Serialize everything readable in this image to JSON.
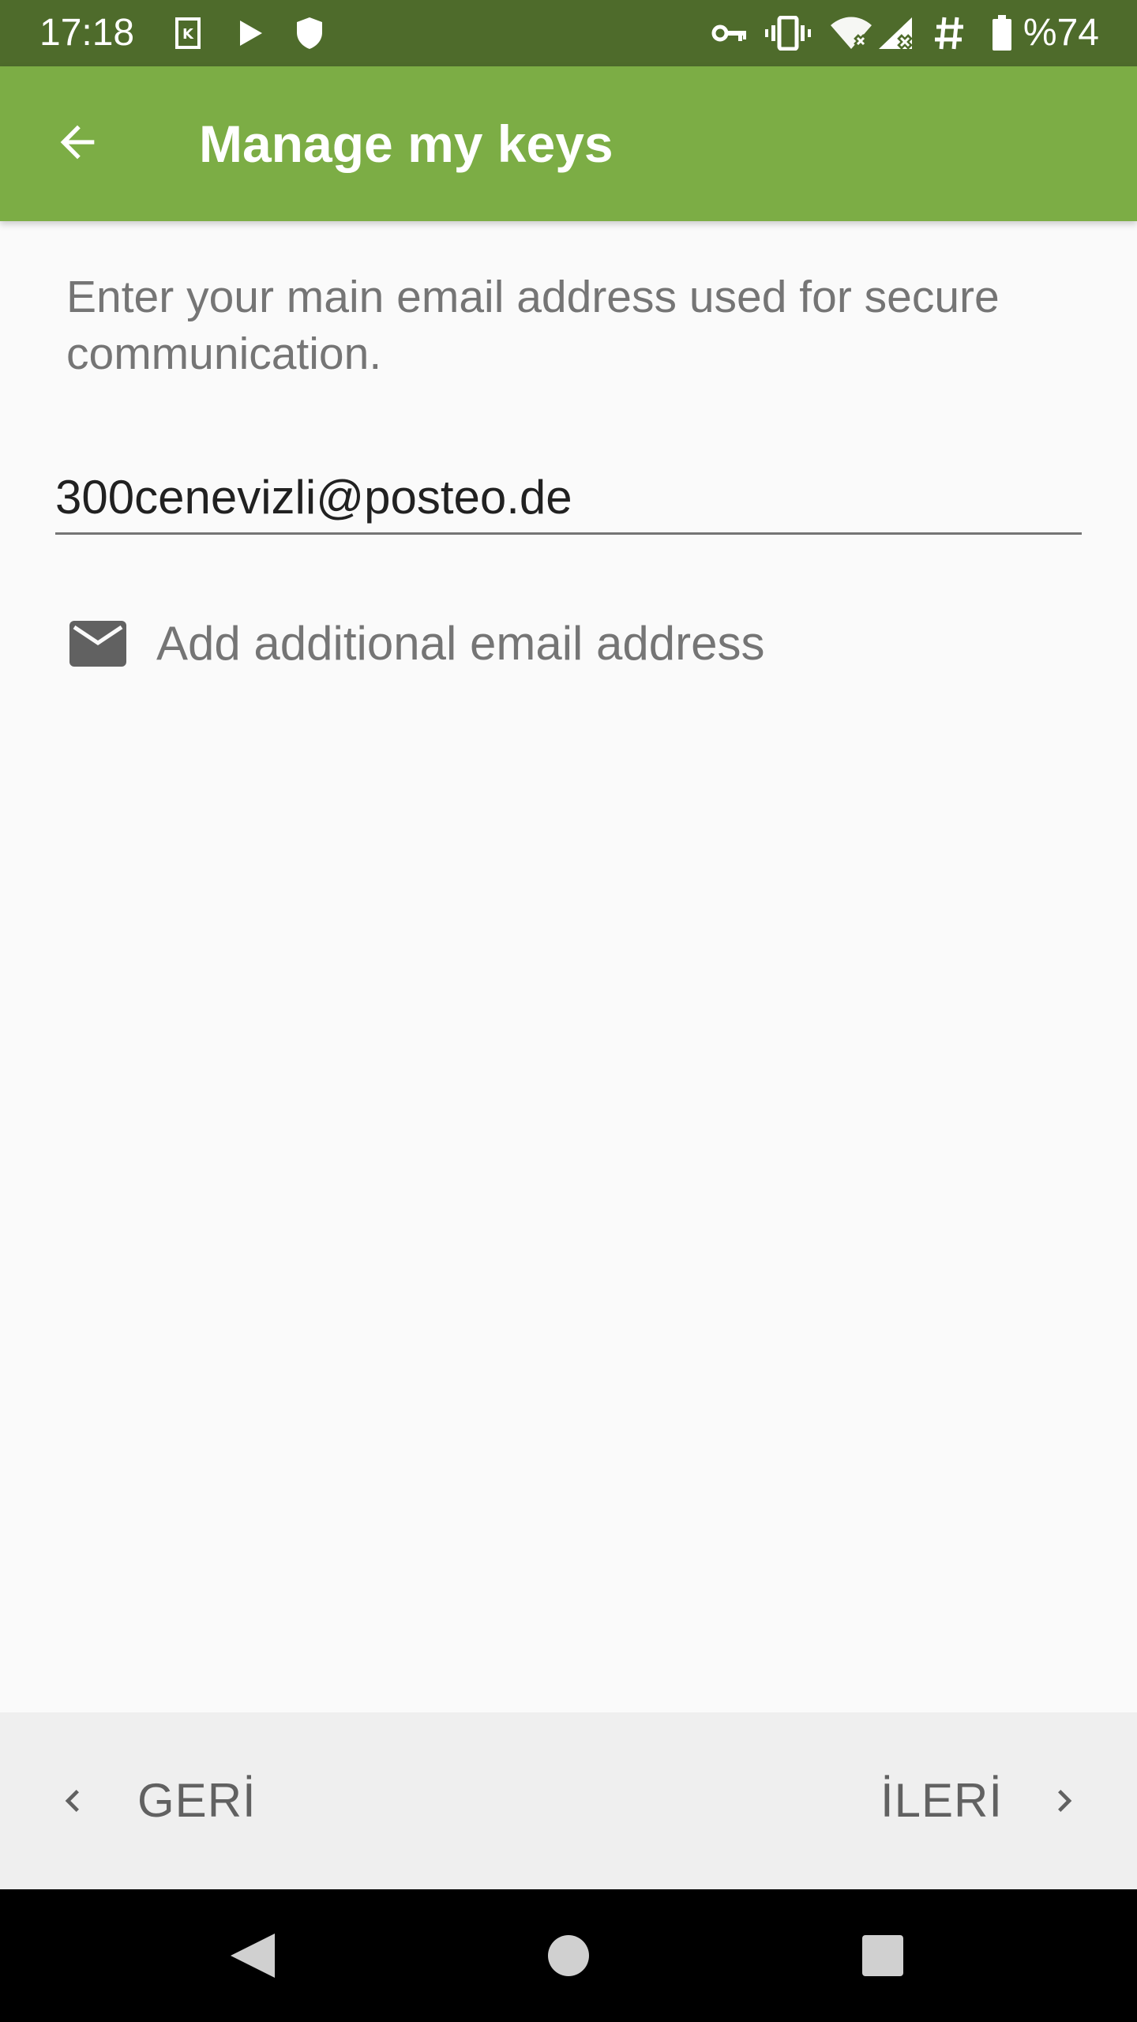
{
  "status_bar": {
    "time": "17:18",
    "battery_text": "%74",
    "left_icons": [
      "k-notification-icon",
      "play-icon",
      "shield-icon"
    ],
    "right_icons": [
      "vpn-key-icon",
      "vibrate-icon",
      "wifi-off-icon",
      "signal-off-icon",
      "hash-icon",
      "battery-icon"
    ]
  },
  "app_bar": {
    "title": "Manage my keys",
    "back_icon": "arrow-back-icon"
  },
  "content": {
    "instruction": "Enter your main email address used for secure communication.",
    "email_value": "300cenevizli@posteo.de",
    "add_email_label": "Add additional email address",
    "add_email_icon": "mail-icon"
  },
  "bottom_bar": {
    "back_label": "GERİ",
    "next_label": "İLERİ"
  },
  "system_nav": {
    "icons": [
      "nav-back-icon",
      "nav-home-icon",
      "nav-recents-icon"
    ]
  },
  "colors": {
    "status_bar": "#4e6b2b",
    "app_bar": "#7cad45",
    "background": "#fafafa",
    "bottom_bar": "#efefef",
    "secondary_text": "#757575"
  }
}
